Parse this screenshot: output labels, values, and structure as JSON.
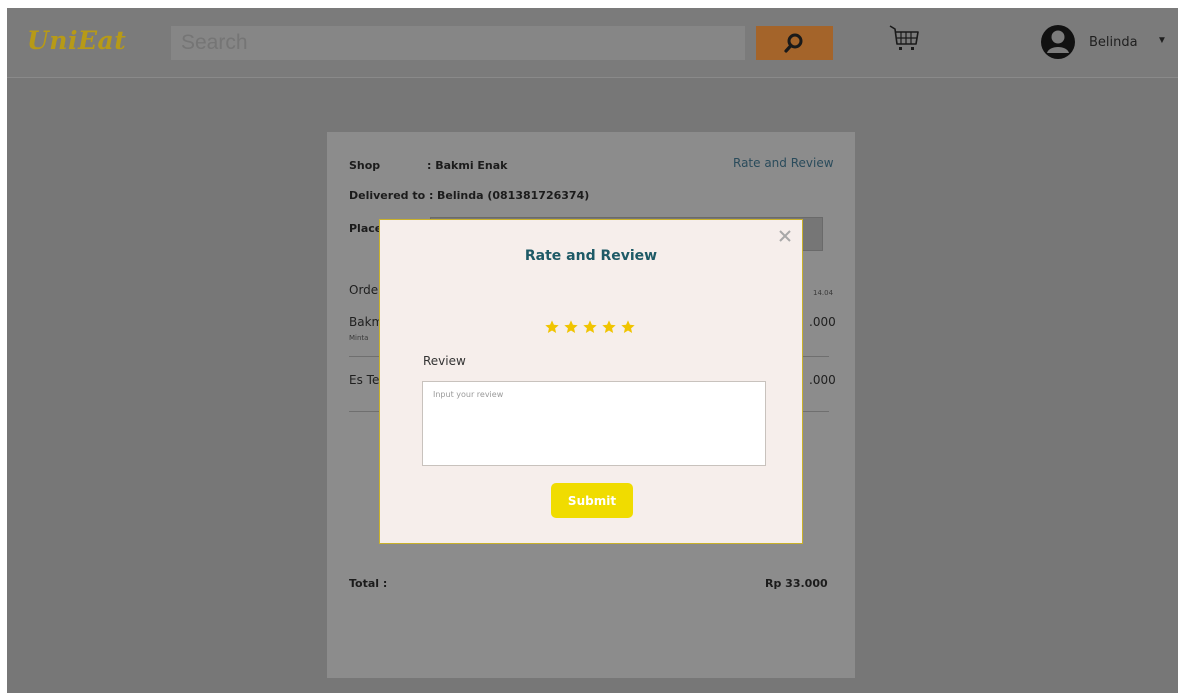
{
  "header": {
    "logo": "UniEat",
    "search_placeholder": "Search",
    "user_name": "Belinda",
    "user_caret": "▼"
  },
  "colors": {
    "accent_yellow": "#f0dc00",
    "search_button": "#a4642a",
    "modal_title": "#1e5a66",
    "star": "#f0c400"
  },
  "icons": [
    "search-icon",
    "cart-icon",
    "user-avatar-icon",
    "close-icon",
    "star-icon"
  ],
  "order": {
    "shop_label": "Shop",
    "shop_value": ": Bakmi Enak",
    "delivered_label": "Delivered to :",
    "delivered_value": "Belinda  (081381726374)",
    "place_label": "Place",
    "rate_link": "Rate and Review",
    "order_label": "Orde",
    "order_time_fragment": "14.04",
    "items": [
      {
        "name_fragment": "Bakm",
        "note_fragment": "Minta",
        "price_fragment": ".000"
      },
      {
        "name_fragment": "Es Te",
        "price_fragment": ".000"
      }
    ],
    "total_label": "Total :",
    "total_value": "Rp 33.000"
  },
  "modal": {
    "title": "Rate and Review",
    "close_glyph": "×",
    "rating": 5,
    "rating_max": 5,
    "review_label": "Review",
    "review_placeholder": "Input your review",
    "review_value": "",
    "submit_label": "Submit"
  }
}
